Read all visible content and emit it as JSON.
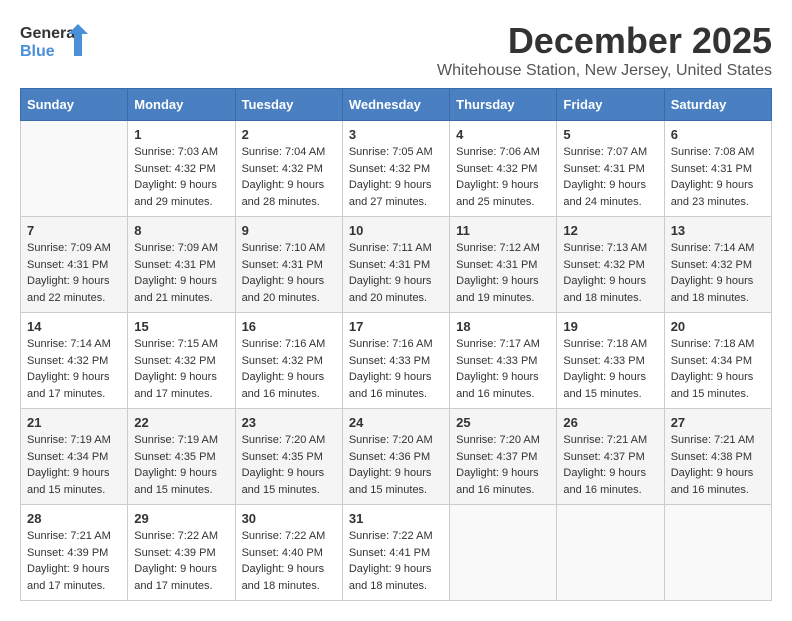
{
  "logo": {
    "general": "General",
    "blue": "Blue"
  },
  "title": "December 2025",
  "subtitle": "Whitehouse Station, New Jersey, United States",
  "days_header": [
    "Sunday",
    "Monday",
    "Tuesday",
    "Wednesday",
    "Thursday",
    "Friday",
    "Saturday"
  ],
  "weeks": [
    [
      {
        "day": "",
        "sunrise": "",
        "sunset": "",
        "daylight": ""
      },
      {
        "day": "1",
        "sunrise": "Sunrise: 7:03 AM",
        "sunset": "Sunset: 4:32 PM",
        "daylight": "Daylight: 9 hours and 29 minutes."
      },
      {
        "day": "2",
        "sunrise": "Sunrise: 7:04 AM",
        "sunset": "Sunset: 4:32 PM",
        "daylight": "Daylight: 9 hours and 28 minutes."
      },
      {
        "day": "3",
        "sunrise": "Sunrise: 7:05 AM",
        "sunset": "Sunset: 4:32 PM",
        "daylight": "Daylight: 9 hours and 27 minutes."
      },
      {
        "day": "4",
        "sunrise": "Sunrise: 7:06 AM",
        "sunset": "Sunset: 4:32 PM",
        "daylight": "Daylight: 9 hours and 25 minutes."
      },
      {
        "day": "5",
        "sunrise": "Sunrise: 7:07 AM",
        "sunset": "Sunset: 4:31 PM",
        "daylight": "Daylight: 9 hours and 24 minutes."
      },
      {
        "day": "6",
        "sunrise": "Sunrise: 7:08 AM",
        "sunset": "Sunset: 4:31 PM",
        "daylight": "Daylight: 9 hours and 23 minutes."
      }
    ],
    [
      {
        "day": "7",
        "sunrise": "Sunrise: 7:09 AM",
        "sunset": "Sunset: 4:31 PM",
        "daylight": "Daylight: 9 hours and 22 minutes."
      },
      {
        "day": "8",
        "sunrise": "Sunrise: 7:09 AM",
        "sunset": "Sunset: 4:31 PM",
        "daylight": "Daylight: 9 hours and 21 minutes."
      },
      {
        "day": "9",
        "sunrise": "Sunrise: 7:10 AM",
        "sunset": "Sunset: 4:31 PM",
        "daylight": "Daylight: 9 hours and 20 minutes."
      },
      {
        "day": "10",
        "sunrise": "Sunrise: 7:11 AM",
        "sunset": "Sunset: 4:31 PM",
        "daylight": "Daylight: 9 hours and 20 minutes."
      },
      {
        "day": "11",
        "sunrise": "Sunrise: 7:12 AM",
        "sunset": "Sunset: 4:31 PM",
        "daylight": "Daylight: 9 hours and 19 minutes."
      },
      {
        "day": "12",
        "sunrise": "Sunrise: 7:13 AM",
        "sunset": "Sunset: 4:32 PM",
        "daylight": "Daylight: 9 hours and 18 minutes."
      },
      {
        "day": "13",
        "sunrise": "Sunrise: 7:14 AM",
        "sunset": "Sunset: 4:32 PM",
        "daylight": "Daylight: 9 hours and 18 minutes."
      }
    ],
    [
      {
        "day": "14",
        "sunrise": "Sunrise: 7:14 AM",
        "sunset": "Sunset: 4:32 PM",
        "daylight": "Daylight: 9 hours and 17 minutes."
      },
      {
        "day": "15",
        "sunrise": "Sunrise: 7:15 AM",
        "sunset": "Sunset: 4:32 PM",
        "daylight": "Daylight: 9 hours and 17 minutes."
      },
      {
        "day": "16",
        "sunrise": "Sunrise: 7:16 AM",
        "sunset": "Sunset: 4:32 PM",
        "daylight": "Daylight: 9 hours and 16 minutes."
      },
      {
        "day": "17",
        "sunrise": "Sunrise: 7:16 AM",
        "sunset": "Sunset: 4:33 PM",
        "daylight": "Daylight: 9 hours and 16 minutes."
      },
      {
        "day": "18",
        "sunrise": "Sunrise: 7:17 AM",
        "sunset": "Sunset: 4:33 PM",
        "daylight": "Daylight: 9 hours and 16 minutes."
      },
      {
        "day": "19",
        "sunrise": "Sunrise: 7:18 AM",
        "sunset": "Sunset: 4:33 PM",
        "daylight": "Daylight: 9 hours and 15 minutes."
      },
      {
        "day": "20",
        "sunrise": "Sunrise: 7:18 AM",
        "sunset": "Sunset: 4:34 PM",
        "daylight": "Daylight: 9 hours and 15 minutes."
      }
    ],
    [
      {
        "day": "21",
        "sunrise": "Sunrise: 7:19 AM",
        "sunset": "Sunset: 4:34 PM",
        "daylight": "Daylight: 9 hours and 15 minutes."
      },
      {
        "day": "22",
        "sunrise": "Sunrise: 7:19 AM",
        "sunset": "Sunset: 4:35 PM",
        "daylight": "Daylight: 9 hours and 15 minutes."
      },
      {
        "day": "23",
        "sunrise": "Sunrise: 7:20 AM",
        "sunset": "Sunset: 4:35 PM",
        "daylight": "Daylight: 9 hours and 15 minutes."
      },
      {
        "day": "24",
        "sunrise": "Sunrise: 7:20 AM",
        "sunset": "Sunset: 4:36 PM",
        "daylight": "Daylight: 9 hours and 15 minutes."
      },
      {
        "day": "25",
        "sunrise": "Sunrise: 7:20 AM",
        "sunset": "Sunset: 4:37 PM",
        "daylight": "Daylight: 9 hours and 16 minutes."
      },
      {
        "day": "26",
        "sunrise": "Sunrise: 7:21 AM",
        "sunset": "Sunset: 4:37 PM",
        "daylight": "Daylight: 9 hours and 16 minutes."
      },
      {
        "day": "27",
        "sunrise": "Sunrise: 7:21 AM",
        "sunset": "Sunset: 4:38 PM",
        "daylight": "Daylight: 9 hours and 16 minutes."
      }
    ],
    [
      {
        "day": "28",
        "sunrise": "Sunrise: 7:21 AM",
        "sunset": "Sunset: 4:39 PM",
        "daylight": "Daylight: 9 hours and 17 minutes."
      },
      {
        "day": "29",
        "sunrise": "Sunrise: 7:22 AM",
        "sunset": "Sunset: 4:39 PM",
        "daylight": "Daylight: 9 hours and 17 minutes."
      },
      {
        "day": "30",
        "sunrise": "Sunrise: 7:22 AM",
        "sunset": "Sunset: 4:40 PM",
        "daylight": "Daylight: 9 hours and 18 minutes."
      },
      {
        "day": "31",
        "sunrise": "Sunrise: 7:22 AM",
        "sunset": "Sunset: 4:41 PM",
        "daylight": "Daylight: 9 hours and 18 minutes."
      },
      {
        "day": "",
        "sunrise": "",
        "sunset": "",
        "daylight": ""
      },
      {
        "day": "",
        "sunrise": "",
        "sunset": "",
        "daylight": ""
      },
      {
        "day": "",
        "sunrise": "",
        "sunset": "",
        "daylight": ""
      }
    ]
  ]
}
